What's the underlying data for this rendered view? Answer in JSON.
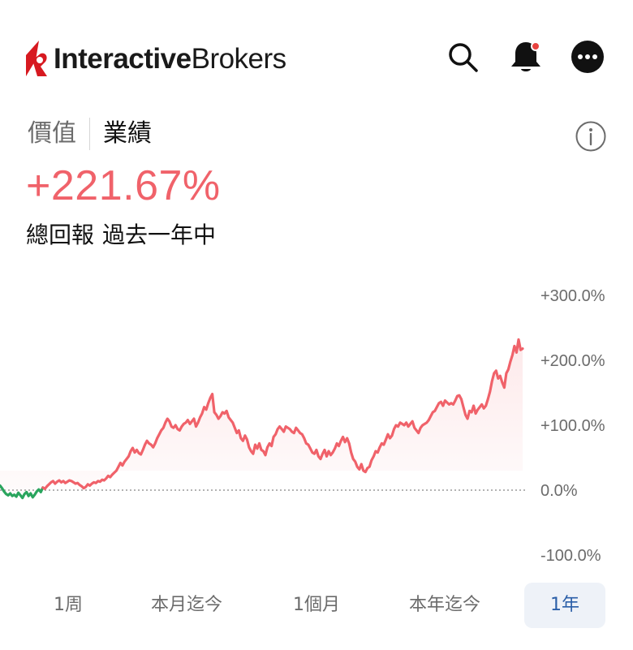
{
  "header": {
    "brand_bold": "Interactive",
    "brand_regular": "Brokers",
    "icons": [
      "search-icon",
      "bell-icon",
      "more-icon"
    ],
    "notification_dot_color": "#e8423f",
    "brand_mark_color": "#d71920"
  },
  "toggle": {
    "value_label": "價值",
    "performance_label": "業績",
    "selected": "業績"
  },
  "performance": {
    "value_text": "+221.67%",
    "label": "總回報",
    "period": "過去一年中",
    "color": "#f0626a"
  },
  "chart_data": {
    "type": "line",
    "y_tick_labels": [
      "+300.0%",
      "+200.0%",
      "+100.0%",
      "0.0%",
      "-100.0%"
    ],
    "y_ticks": [
      300,
      200,
      100,
      0,
      -100
    ],
    "ylim": [
      -100,
      300
    ],
    "baseline": 0,
    "positive_color": "#f0626a",
    "negative_color": "#2aa55e",
    "y": [
      7,
      3,
      -2,
      -6,
      -8,
      -5,
      -9,
      -7,
      -10,
      -4,
      -8,
      -12,
      -6,
      -3,
      -9,
      -5,
      -11,
      -7,
      -2,
      1,
      -3,
      4,
      2,
      6,
      9,
      12,
      14,
      10,
      13,
      15,
      12,
      14,
      11,
      13,
      15,
      14,
      12,
      10,
      11,
      8,
      6,
      3,
      5,
      9,
      7,
      10,
      12,
      11,
      14,
      13,
      16,
      15,
      18,
      22,
      20,
      24,
      27,
      30,
      36,
      42,
      38,
      44,
      48,
      52,
      60,
      65,
      58,
      62,
      57,
      55,
      62,
      70,
      76,
      72,
      70,
      66,
      72,
      80,
      86,
      92,
      96,
      104,
      110,
      106,
      98,
      96,
      100,
      94,
      92,
      98,
      102,
      104,
      108,
      102,
      106,
      110,
      98,
      104,
      112,
      118,
      128,
      124,
      134,
      142,
      148,
      120,
      116,
      110,
      114,
      120,
      118,
      122,
      112,
      108,
      104,
      96,
      88,
      92,
      80,
      76,
      84,
      78,
      66,
      60,
      56,
      70,
      64,
      72,
      62,
      60,
      54,
      66,
      72,
      68,
      82,
      86,
      94,
      98,
      94,
      90,
      98,
      96,
      94,
      90,
      88,
      96,
      92,
      88,
      86,
      80,
      72,
      70,
      64,
      58,
      56,
      62,
      52,
      48,
      56,
      62,
      52,
      60,
      54,
      58,
      64,
      72,
      68,
      76,
      82,
      74,
      80,
      72,
      58,
      48,
      44,
      36,
      32,
      40,
      30,
      28,
      34,
      36,
      46,
      52,
      60,
      58,
      66,
      72,
      70,
      78,
      86,
      80,
      84,
      94,
      100,
      98,
      104,
      102,
      100,
      104,
      98,
      102,
      106,
      96,
      92,
      88,
      96,
      100,
      102,
      104,
      108,
      114,
      120,
      122,
      128,
      134,
      136,
      130,
      138,
      135,
      132,
      134,
      132,
      138,
      145,
      146,
      140,
      128,
      116,
      110,
      122,
      120,
      130,
      118,
      124,
      128,
      132,
      126,
      130,
      140,
      152,
      168,
      180,
      184,
      172,
      176,
      166,
      158,
      180,
      186,
      198,
      208,
      222,
      212,
      232,
      216,
      218
    ]
  },
  "ranges": {
    "items": [
      "1周",
      "本月迄今",
      "1個月",
      "本年迄今",
      "1年"
    ],
    "selected": "1年"
  }
}
